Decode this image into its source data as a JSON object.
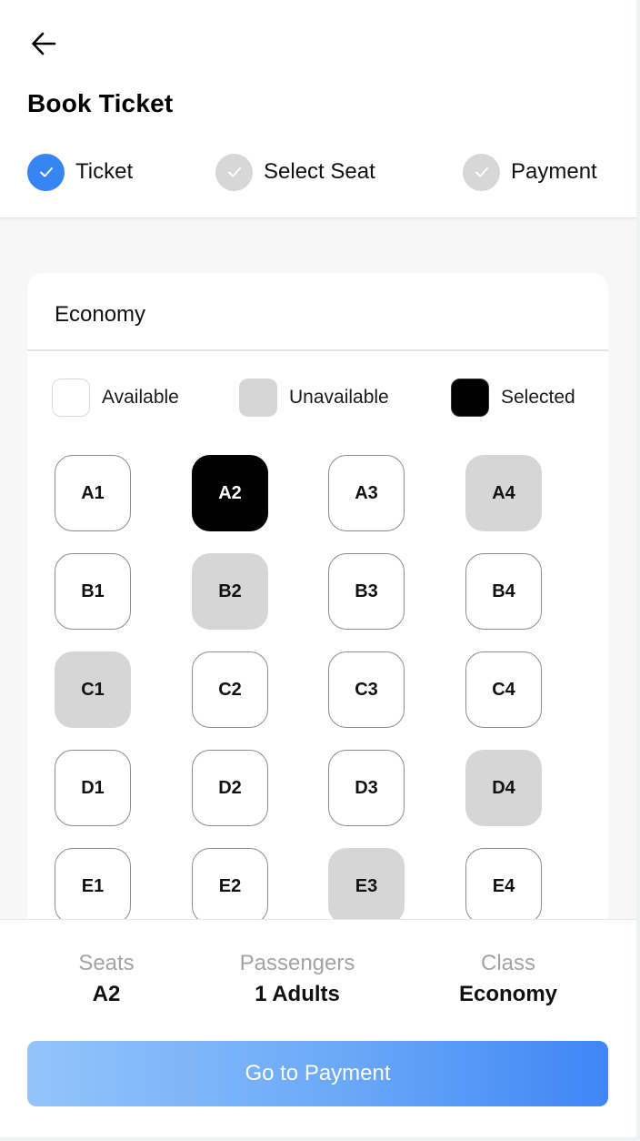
{
  "header": {
    "back_icon": "arrow-left-icon",
    "title": "Book Ticket",
    "steps": [
      {
        "label": "Ticket",
        "state": "done",
        "icon": "check-icon",
        "color": "#3784f5"
      },
      {
        "label": "Select Seat",
        "state": "pending",
        "icon": "check-icon",
        "color": "#d7d7d7"
      },
      {
        "label": "Payment",
        "state": "pending",
        "icon": "check-icon",
        "color": "#d7d7d7"
      }
    ]
  },
  "seat_map": {
    "class_title": "Economy",
    "legend": {
      "available": "Available",
      "unavailable": "Unavailable",
      "selected": "Selected"
    },
    "rows": [
      {
        "row": "A",
        "seats": [
          {
            "label": "A1",
            "status": "available"
          },
          {
            "label": "A2",
            "status": "selected"
          },
          {
            "label": "A3",
            "status": "available"
          },
          {
            "label": "A4",
            "status": "unavailable"
          }
        ]
      },
      {
        "row": "B",
        "seats": [
          {
            "label": "B1",
            "status": "available"
          },
          {
            "label": "B2",
            "status": "unavailable"
          },
          {
            "label": "B3",
            "status": "available"
          },
          {
            "label": "B4",
            "status": "available"
          }
        ]
      },
      {
        "row": "C",
        "seats": [
          {
            "label": "C1",
            "status": "unavailable"
          },
          {
            "label": "C2",
            "status": "available"
          },
          {
            "label": "C3",
            "status": "available"
          },
          {
            "label": "C4",
            "status": "available"
          }
        ]
      },
      {
        "row": "D",
        "seats": [
          {
            "label": "D1",
            "status": "available"
          },
          {
            "label": "D2",
            "status": "available"
          },
          {
            "label": "D3",
            "status": "available"
          },
          {
            "label": "D4",
            "status": "unavailable"
          }
        ]
      },
      {
        "row": "E",
        "seats": [
          {
            "label": "E1",
            "status": "available"
          },
          {
            "label": "E2",
            "status": "available"
          },
          {
            "label": "E3",
            "status": "unavailable"
          },
          {
            "label": "E4",
            "status": "available"
          }
        ]
      }
    ]
  },
  "summary": {
    "seats_label": "Seats",
    "seats_value": "A2",
    "passengers_label": "Passengers",
    "passengers_value": "1 Adults",
    "class_label": "Class",
    "class_value": "Economy"
  },
  "actions": {
    "go_to_payment": "Go to Payment"
  },
  "colors": {
    "accent": "#3784f5",
    "button_gradient_start": "#93c4fb",
    "button_gradient_end": "#3f86f6",
    "unavailable": "#d6d6d6",
    "selected": "#000000"
  }
}
